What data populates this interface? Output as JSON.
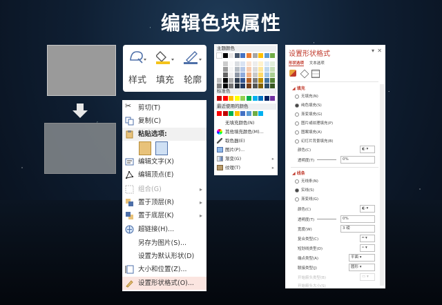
{
  "title": "编辑色块属性",
  "ribbon": {
    "style_label": "样式",
    "fill_label": "填充",
    "outline_label": "轮廓",
    "fill_color": "#f4c31b"
  },
  "context_menu": {
    "cut": "剪切(T)",
    "copy": "复制(C)",
    "paste_options": "粘贴选项:",
    "edit_text": "编辑文字(X)",
    "edit_points": "编辑顶点(E)",
    "group": "组合(G)",
    "bring_front": "置于顶层(R)",
    "send_back": "置于底层(K)",
    "hyperlink": "超链接(H)...",
    "save_as_picture": "另存为图片(S)...",
    "set_default": "设置为默认形状(D)",
    "size_position": "大小和位置(Z)...",
    "format_shape": "设置形状格式(O)..."
  },
  "palette": {
    "theme_colors": "主题颜色",
    "standard_colors": "标准色",
    "recent_colors": "最近使用的颜色",
    "no_fill": "无填充颜色(N)",
    "more_colors": "其他填充颜色(M)...",
    "eyedropper": "取色器(E)",
    "picture": "图片(P)...",
    "gradient": "渐变(G)",
    "texture": "纹理(T)",
    "theme_top": [
      "#ffffff",
      "#000000",
      "#e7e6e6",
      "#44546a",
      "#4472c4",
      "#ed7d31",
      "#a5a5a5",
      "#ffc000",
      "#5b9bd5",
      "#70ad47"
    ],
    "standard": [
      "#c00000",
      "#ff0000",
      "#ffc000",
      "#ffff00",
      "#92d050",
      "#00b050",
      "#00b0f0",
      "#0070c0",
      "#002060",
      "#7030a0"
    ],
    "recent": [
      "#ff0000",
      "#c00000",
      "#00b050",
      "#ffc000",
      "#4472c4",
      "#5b9bd5",
      "#70ad47",
      "#00b0f0"
    ]
  },
  "format_pane": {
    "title": "设置形状格式",
    "tab_shape": "形状选项",
    "tab_text": "文本选项",
    "fill_section": "填充",
    "fill_options": [
      "无填充(N)",
      "纯色填充(S)",
      "渐变填充(G)",
      "图片或纹理填充(P)",
      "图案填充(A)",
      "幻灯片背景填充(B)"
    ],
    "fill_selected_index": 1,
    "color_label": "颜色(C)",
    "transparency_label": "透明度(T)",
    "transparency_value": "0%",
    "line_section": "线条",
    "line_options": [
      "无线条(N)",
      "实线(S)",
      "渐变线(G)"
    ],
    "line_selected_index": 1,
    "line_color_label": "颜色(C)",
    "line_transparency_label": "透明度(T)",
    "line_transparency_value": "0%",
    "width_label": "宽度(W)",
    "width_value": "3 磅",
    "compound_label": "复合类型(C)",
    "dash_label": "短划线类型(D)",
    "cap_label": "端点类型(A)",
    "cap_value": "平面",
    "join_label": "联接类型(J)",
    "join_value": "圆形",
    "begin_arrow_label": "开始箭头类型(B)",
    "begin_arrow_size_label": "开始箭头大小(S)"
  }
}
